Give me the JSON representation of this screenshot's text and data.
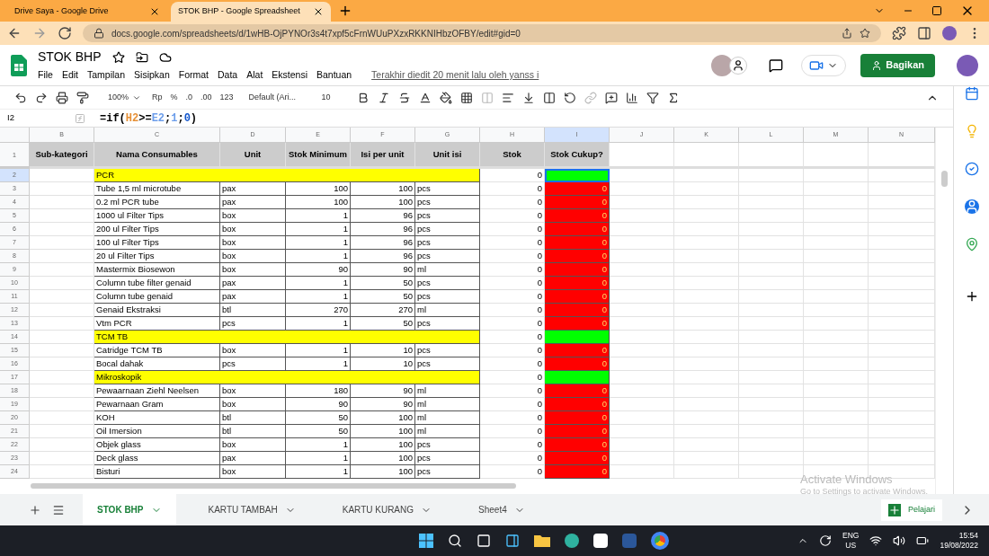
{
  "browser": {
    "tabs": [
      {
        "label": "Drive Saya - Google Drive",
        "selected": false
      },
      {
        "label": "STOK BHP - Google Spreadsheet",
        "selected": true
      }
    ],
    "url": "docs.google.com/spreadsheets/d/1wHB-OjPYNOr3s4t7xpf5cFrnWUuPXzxRKKNIHbzOFBY/edit#gid=0"
  },
  "doc": {
    "title": "STOK BHP",
    "menus": [
      "File",
      "Edit",
      "Tampilan",
      "Sisipkan",
      "Format",
      "Data",
      "Alat",
      "Ekstensi",
      "Bantuan"
    ],
    "last_edit": "Terakhir diedit 20 menit lalu oleh yanss i",
    "share": "Bagikan"
  },
  "toolbar": {
    "zoom": "100%",
    "currency": "Rp",
    "percent": "%",
    "dec_less": ".0",
    "dec_more": ".00",
    "format": "123",
    "font": "Default (Ari...",
    "size": "10"
  },
  "formula_bar": {
    "cell": "I2",
    "parts": [
      {
        "text": "=if(",
        "color": "#000000"
      },
      {
        "text": "H2",
        "color": "#e69138"
      },
      {
        "text": ">=",
        "color": "#000000"
      },
      {
        "text": "E2",
        "color": "#6d9eeb"
      },
      {
        "text": ";",
        "color": "#000000"
      },
      {
        "text": "1",
        "color": "#6d9eeb"
      },
      {
        "text": ";",
        "color": "#000000"
      },
      {
        "text": "0",
        "color": "#1155cc"
      },
      {
        "text": ")",
        "color": "#000000"
      }
    ]
  },
  "header_row_num": "1",
  "columns": [
    {
      "letter": "B",
      "header": "Sub-kategori",
      "selected": false
    },
    {
      "letter": "C",
      "header": "Nama Consumables",
      "selected": false
    },
    {
      "letter": "D",
      "header": "Unit",
      "selected": false
    },
    {
      "letter": "E",
      "header": "Stok Minimum",
      "selected": false
    },
    {
      "letter": "F",
      "header": "Isi per unit",
      "selected": false
    },
    {
      "letter": "G",
      "header": "Unit isi",
      "selected": false
    },
    {
      "letter": "H",
      "header": "Stok",
      "selected": false
    },
    {
      "letter": "I",
      "header": "Stok Cukup?",
      "selected": true
    },
    {
      "letter": "J",
      "selected": false
    },
    {
      "letter": "K",
      "selected": false
    },
    {
      "letter": "L",
      "selected": false
    },
    {
      "letter": "M",
      "selected": false
    },
    {
      "letter": "N",
      "selected": false
    }
  ],
  "rows": [
    {
      "num": "2",
      "kind": "group",
      "name": "PCR",
      "stok": "0",
      "enough": true,
      "selected": true
    },
    {
      "num": "3",
      "kind": "item",
      "name": "Tube 1,5 ml microtube",
      "unit": "pax",
      "min": "100",
      "isi": "100",
      "unit_isi": "pcs",
      "stok": "0",
      "check": "0",
      "enough": false,
      "selected": false
    },
    {
      "num": "4",
      "kind": "item",
      "name": "0.2 ml PCR tube",
      "unit": "pax",
      "min": "100",
      "isi": "100",
      "unit_isi": "pcs",
      "stok": "0",
      "check": "0",
      "enough": false,
      "selected": false
    },
    {
      "num": "5",
      "kind": "item",
      "name": "1000 ul Filter Tips",
      "unit": "box",
      "min": "1",
      "isi": "96",
      "unit_isi": "pcs",
      "stok": "0",
      "check": "0",
      "enough": false,
      "selected": false
    },
    {
      "num": "6",
      "kind": "item",
      "name": "200 ul Filter Tips",
      "unit": "box",
      "min": "1",
      "isi": "96",
      "unit_isi": "pcs",
      "stok": "0",
      "check": "0",
      "enough": false,
      "selected": false
    },
    {
      "num": "7",
      "kind": "item",
      "name": "100 ul Filter Tips",
      "unit": "box",
      "min": "1",
      "isi": "96",
      "unit_isi": "pcs",
      "stok": "0",
      "check": "0",
      "enough": false,
      "selected": false
    },
    {
      "num": "8",
      "kind": "item",
      "name": "20 ul Filter Tips",
      "unit": "box",
      "min": "1",
      "isi": "96",
      "unit_isi": "pcs",
      "stok": "0",
      "check": "0",
      "enough": false,
      "selected": false
    },
    {
      "num": "9",
      "kind": "item",
      "name": "Mastermix Biosewon",
      "unit": "box",
      "min": "90",
      "isi": "90",
      "unit_isi": "ml",
      "stok": "0",
      "check": "0",
      "enough": false,
      "selected": false
    },
    {
      "num": "10",
      "kind": "item",
      "name": "Column tube filter genaid",
      "unit": "pax",
      "min": "1",
      "isi": "50",
      "unit_isi": "pcs",
      "stok": "0",
      "check": "0",
      "enough": false,
      "selected": false
    },
    {
      "num": "11",
      "kind": "item",
      "name": "Column tube genaid",
      "unit": "pax",
      "min": "1",
      "isi": "50",
      "unit_isi": "pcs",
      "stok": "0",
      "check": "0",
      "enough": false,
      "selected": false
    },
    {
      "num": "12",
      "kind": "item",
      "name": "Genaid Ekstraksi",
      "unit": "btl",
      "min": "270",
      "isi": "270",
      "unit_isi": "ml",
      "stok": "0",
      "check": "0",
      "enough": false,
      "selected": false
    },
    {
      "num": "13",
      "kind": "item",
      "name": "Vtm PCR",
      "unit": "pcs",
      "min": "1",
      "isi": "50",
      "unit_isi": "pcs",
      "stok": "0",
      "check": "0",
      "enough": false,
      "selected": false
    },
    {
      "num": "14",
      "kind": "group",
      "name": "TCM TB",
      "stok": "0",
      "enough": true,
      "selected": false
    },
    {
      "num": "15",
      "kind": "item",
      "name": "Catridge TCM TB",
      "unit": "box",
      "min": "1",
      "isi": "10",
      "unit_isi": "pcs",
      "stok": "0",
      "check": "0",
      "enough": false,
      "selected": false
    },
    {
      "num": "16",
      "kind": "item",
      "name": "Bocal dahak",
      "unit": "pcs",
      "min": "1",
      "isi": "10",
      "unit_isi": "pcs",
      "stok": "0",
      "check": "0",
      "enough": false,
      "selected": false
    },
    {
      "num": "17",
      "kind": "group",
      "name": "Mikroskopik",
      "stok": "0",
      "enough": true,
      "selected": false
    },
    {
      "num": "18",
      "kind": "item",
      "name": "Pewaarnaan Ziehl Neelsen",
      "unit": "box",
      "min": "180",
      "isi": "90",
      "unit_isi": "ml",
      "stok": "0",
      "check": "0",
      "enough": false,
      "selected": false
    },
    {
      "num": "19",
      "kind": "item",
      "name": "Pewarnaan Gram",
      "unit": "box",
      "min": "90",
      "isi": "90",
      "unit_isi": "ml",
      "stok": "0",
      "check": "0",
      "enough": false,
      "selected": false
    },
    {
      "num": "20",
      "kind": "item",
      "name": "KOH",
      "unit": "btl",
      "min": "50",
      "isi": "100",
      "unit_isi": "ml",
      "stok": "0",
      "check": "0",
      "enough": false,
      "selected": false
    },
    {
      "num": "21",
      "kind": "item",
      "name": "Oil Imersion",
      "unit": "btl",
      "min": "50",
      "isi": "100",
      "unit_isi": "ml",
      "stok": "0",
      "check": "0",
      "enough": false,
      "selected": false
    },
    {
      "num": "22",
      "kind": "item",
      "name": "Objek glass",
      "unit": "box",
      "min": "1",
      "isi": "100",
      "unit_isi": "pcs",
      "stok": "0",
      "check": "0",
      "enough": false,
      "selected": false
    },
    {
      "num": "23",
      "kind": "item",
      "name": "Deck glass",
      "unit": "pax",
      "min": "1",
      "isi": "100",
      "unit_isi": "pcs",
      "stok": "0",
      "check": "0",
      "enough": false,
      "selected": false
    },
    {
      "num": "24",
      "kind": "item",
      "name": "Bisturi",
      "unit": "box",
      "min": "1",
      "isi": "100",
      "unit_isi": "pcs",
      "stok": "0",
      "check": "0",
      "enough": false,
      "selected": false
    }
  ],
  "sheets": [
    {
      "label": "STOK BHP",
      "selected": true
    },
    {
      "label": "KARTU TAMBAH",
      "selected": false
    },
    {
      "label": "KARTU KURANG",
      "selected": false
    },
    {
      "label": "Sheet4",
      "selected": false
    }
  ],
  "explore": "Pelajari",
  "activation": {
    "title": "Activate Windows",
    "text": "Go to Settings to activate Windows."
  },
  "taskbar": {
    "lang": "ENG",
    "region": "US",
    "time": "15:54",
    "date": "19/08/2022"
  }
}
